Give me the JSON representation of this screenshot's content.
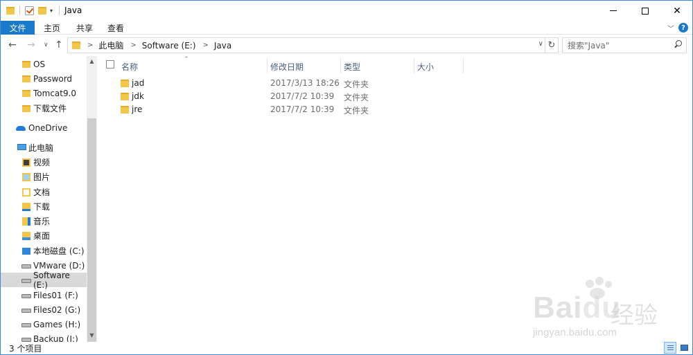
{
  "window": {
    "title": "Java"
  },
  "ribbon": {
    "tabs": [
      "文件",
      "主页",
      "共享",
      "查看"
    ]
  },
  "address": {
    "crumbs": [
      "此电脑",
      "Software (E:)",
      "Java"
    ]
  },
  "search": {
    "placeholder": "搜索\"Java\""
  },
  "nav": {
    "items": [
      {
        "label": "OS",
        "icon": "folder-icon"
      },
      {
        "label": "Password",
        "icon": "folder-icon"
      },
      {
        "label": "Tomcat9.0",
        "icon": "folder-icon"
      },
      {
        "label": "下载文件",
        "icon": "folder-icon"
      },
      {
        "label": "OneDrive",
        "icon": "onedrive-icon"
      },
      {
        "label": "此电脑",
        "icon": "this-pc-icon"
      },
      {
        "label": "视频",
        "icon": "videos-folder-icon"
      },
      {
        "label": "图片",
        "icon": "pictures-folder-icon"
      },
      {
        "label": "文档",
        "icon": "documents-folder-icon"
      },
      {
        "label": "下载",
        "icon": "downloads-folder-icon"
      },
      {
        "label": "音乐",
        "icon": "music-folder-icon"
      },
      {
        "label": "桌面",
        "icon": "desktop-folder-icon"
      },
      {
        "label": "本地磁盘 (C:)",
        "icon": "windows-drive-icon"
      },
      {
        "label": "VMware (D:)",
        "icon": "drive-icon"
      },
      {
        "label": "Software (E:)",
        "icon": "drive-icon"
      },
      {
        "label": "Files01 (F:)",
        "icon": "drive-icon"
      },
      {
        "label": "Files02 (G:)",
        "icon": "drive-icon"
      },
      {
        "label": "Games (H:)",
        "icon": "drive-icon"
      },
      {
        "label": "Backup (I:)",
        "icon": "drive-icon"
      }
    ]
  },
  "columns": {
    "name": "名称",
    "date": "修改日期",
    "type": "类型",
    "size": "大小"
  },
  "files": [
    {
      "name": "jad",
      "date": "2017/3/13 18:26",
      "type": "文件夹",
      "size": ""
    },
    {
      "name": "jdk",
      "date": "2017/7/2 10:39",
      "type": "文件夹",
      "size": ""
    },
    {
      "name": "jre",
      "date": "2017/7/2 10:39",
      "type": "文件夹",
      "size": ""
    }
  ],
  "status": {
    "count": "3 个项目"
  },
  "watermark": {
    "brand": "Bai",
    "brand2": "du",
    "cn": "经验",
    "url": "jingyan.baidu.com"
  },
  "colors": {
    "accent": "#1979ca",
    "folder": "#f3c64a",
    "selected": "#d9d9d9"
  }
}
